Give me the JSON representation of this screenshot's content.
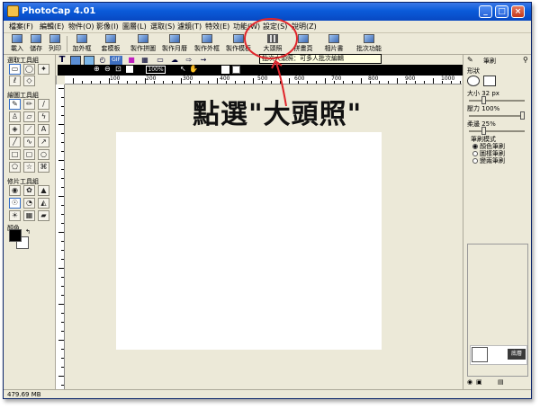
{
  "window": {
    "title": "PhotoCap 4.01",
    "controls": [
      "_",
      "□",
      "×"
    ]
  },
  "menu": [
    "檔案(F)",
    "編輯(E)",
    "物件(O)",
    "影像(I)",
    "圖層(L)",
    "選取(S)",
    "濾鏡(T)",
    "特效(E)",
    "功能(W)",
    "設定(S)",
    "說明(Z)"
  ],
  "toolbar": [
    "載入",
    "儲存",
    "列印",
    "加外框",
    "套模板",
    "製作拼圖",
    "製作月曆",
    "製作外框",
    "製作模板",
    "大頭照",
    "拼畫頁",
    "相片書",
    "批次功能"
  ],
  "left_panel": {
    "select_title": "選取工具組",
    "draw_title": "繪圖工具組",
    "photo_title": "修片工具組",
    "color_title": "顏色"
  },
  "options_bar": {
    "zoom": "100%"
  },
  "hint": "批次大頭照：可多人批次編輯",
  "annotation": "點選\"大頭照\"",
  "ruler_labels": [
    "100",
    "200",
    "300",
    "400",
    "500",
    "600",
    "700",
    "800",
    "900",
    "1000"
  ],
  "right_panel": {
    "title": "筆刷",
    "shape_label": "形狀",
    "size_label": "大小 32 px",
    "size_value": 0.25,
    "pressure_label": "壓力 100%",
    "pressure_value": 1.0,
    "soft_label": "柔邊 25%",
    "soft_value": 0.25,
    "mode_title": "筆刷模式",
    "modes": [
      "顏色筆刷",
      "圖樣筆刷",
      "變兩筆刷"
    ],
    "layer_label": "底層",
    "tabs": [
      "圖層",
      "色板",
      "資訊"
    ]
  },
  "status": {
    "memory": "479.69 MB"
  },
  "colors": {
    "title_start": "#3b78e7",
    "title_end": "#0848c2",
    "chrome": "#ece9d8",
    "annotation_circle": "#e0252b"
  }
}
